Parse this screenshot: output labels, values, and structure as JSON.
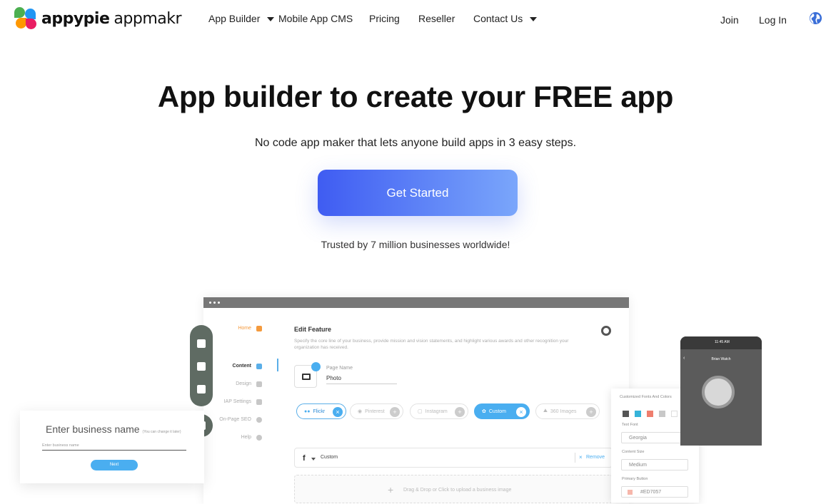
{
  "brand": {
    "name": "appypie",
    "product": "appmakr"
  },
  "nav": {
    "items": [
      "App Builder",
      "Mobile App CMS",
      "Pricing",
      "Reseller",
      "Contact Us"
    ],
    "join": "Join",
    "login": "Log In"
  },
  "hero": {
    "title": "App builder to create your FREE app",
    "subtitle": "No code app maker that lets anyone build apps in 3 easy steps.",
    "cta": "Get Started",
    "trust": "Trusted by 7 million businesses worldwide!"
  },
  "mockup": {
    "sidebar": [
      "Home",
      "Content",
      "Design",
      "IAP Settings",
      "On-Page SEO",
      "Help"
    ],
    "edit_title": "Edit Feature",
    "edit_desc": "Specify the core line of your business, provide mission and vision statements, and highlight various awards and other recognition your organization has received.",
    "page_name_label": "Page Name",
    "page_name_value": "Photo",
    "chips": [
      "Flickr",
      "Pinterest",
      "Instagram",
      "Custom",
      "360 Images"
    ],
    "custom_row": "Custom",
    "remove": "Remove",
    "drop_text": "Drag & Drop or Click to upload a business image",
    "business_name": "Enter business name",
    "business_note": "(You can change it later)",
    "business_placeholder": "Enter business name",
    "next": "Next",
    "panel_title": "Customized Fonts And Colors",
    "text_font_label": "Text Font",
    "text_font_value": "Georgia",
    "content_size_label": "Content Size",
    "content_size_value": "Medium",
    "primary_button_label": "Primary Button",
    "primary_button_value": "#ED7057",
    "swatches": [
      "#555555",
      "#36b3d9",
      "#ef7e6e",
      "#c8c8c8",
      "#ffffff",
      "#ef4b45"
    ],
    "phone_time": "11:45 AM",
    "phone_title": "Brian Watch"
  },
  "colors": {
    "cta_start": "#3f5cf2",
    "cta_end": "#7aa6fb",
    "accent_orange": "#f49a3d",
    "accent_blue": "#4aaef0"
  }
}
